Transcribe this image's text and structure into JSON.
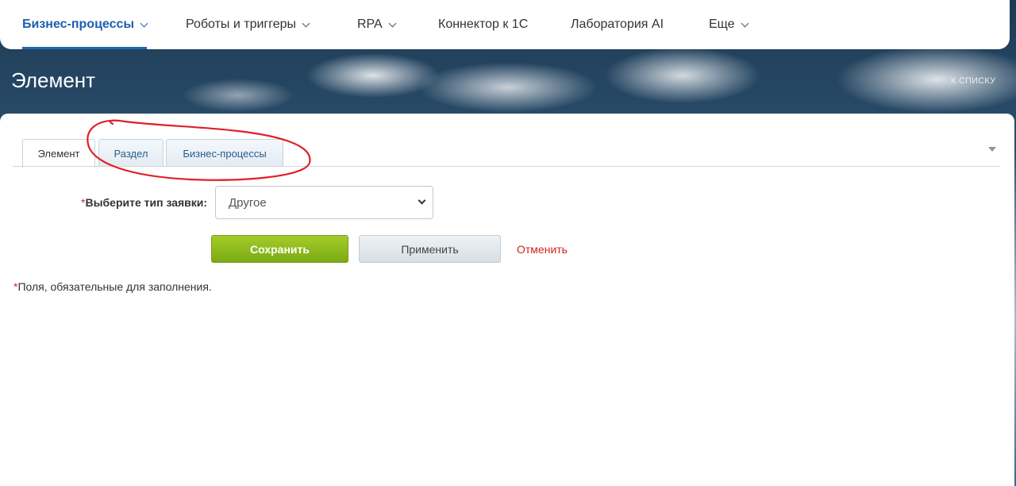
{
  "nav": {
    "items": [
      {
        "label": "Бизнес-процессы",
        "active": true,
        "dropdown": true
      },
      {
        "label": "Роботы и триггеры",
        "active": false,
        "dropdown": true
      },
      {
        "label": "RPA",
        "active": false,
        "dropdown": true
      },
      {
        "label": "Коннектор к 1С",
        "active": false,
        "dropdown": false
      },
      {
        "label": "Лаборатория AI",
        "active": false,
        "dropdown": false
      },
      {
        "label": "Еще",
        "active": false,
        "dropdown": true
      }
    ]
  },
  "header": {
    "title": "Элемент",
    "back_link": "К СПИСКУ"
  },
  "tabs": [
    {
      "label": "Элемент",
      "active": true
    },
    {
      "label": "Раздел",
      "active": false
    },
    {
      "label": "Бизнес-процессы",
      "active": false
    }
  ],
  "form": {
    "required_mark": "*",
    "request_type_label": "Выберите тип заявки:",
    "request_type_value": "Другое"
  },
  "actions": {
    "save_label": "Сохранить",
    "apply_label": "Применить",
    "cancel_label": "Отменить"
  },
  "footnote": {
    "mark": "*",
    "text": "Поля, обязательные для заполнения."
  },
  "colors": {
    "accent": "#1d5fae",
    "save_green": "#8bbb1c",
    "cancel_red": "#d0241f",
    "annotation_red": "#e0202a"
  }
}
